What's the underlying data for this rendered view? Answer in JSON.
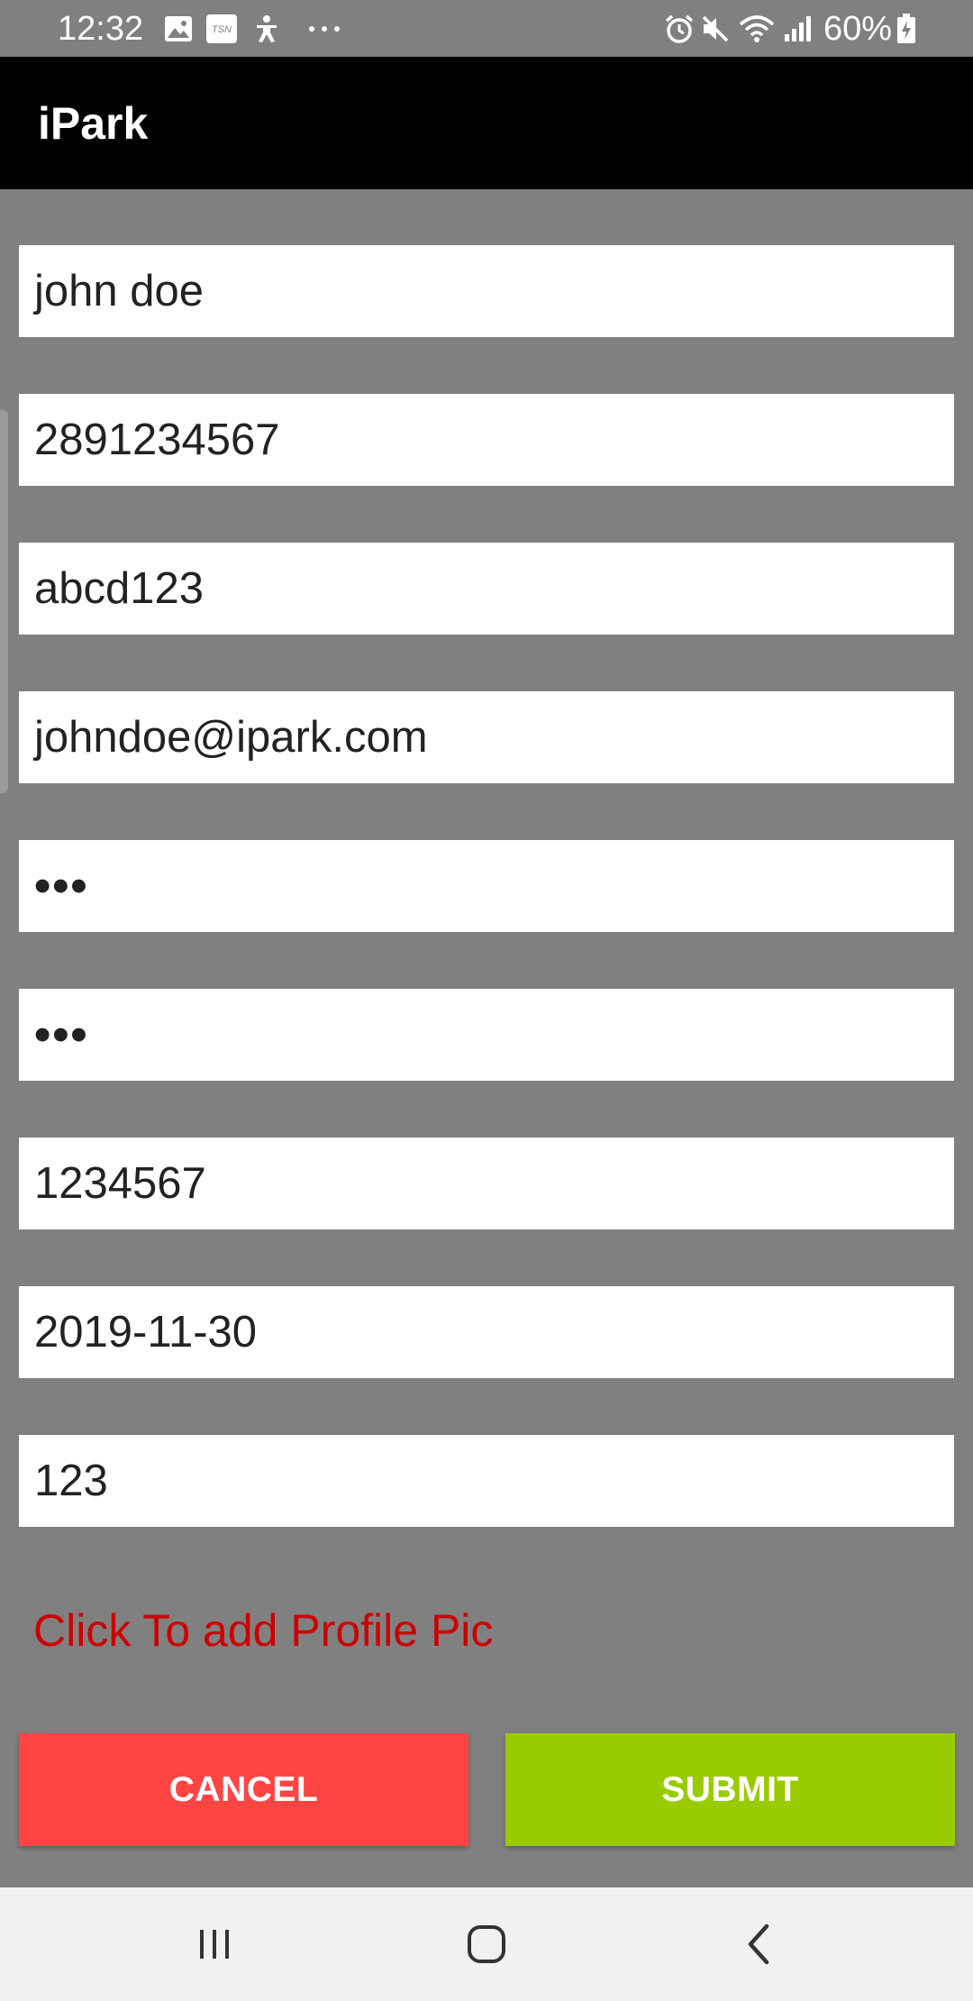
{
  "status_bar": {
    "time": "12:32",
    "battery_percent": "60%",
    "icons": [
      "gallery-icon",
      "tsn-icon",
      "accessibility-icon",
      "more-notifications-icon",
      "alarm-icon",
      "mute-icon",
      "wifi-icon",
      "signal-icon",
      "battery-charging-icon"
    ]
  },
  "app_bar": {
    "title": "iPark"
  },
  "form": {
    "fields": [
      {
        "value": "john doe"
      },
      {
        "value": "2891234567"
      },
      {
        "value": "abcd123"
      },
      {
        "value": "johndoe@ipark.com"
      },
      {
        "value": "•••"
      },
      {
        "value": "•••"
      },
      {
        "value": "1234567"
      },
      {
        "value": "2019-11-30"
      },
      {
        "value": "123"
      }
    ],
    "profile_pic_link": "Click To add Profile Pic",
    "cancel_label": "CANCEL",
    "submit_label": "SUBMIT"
  },
  "colors": {
    "background": "#808080",
    "app_bar": "#000000",
    "cancel": "#ff4444",
    "submit": "#99cc00",
    "link": "#cc0000"
  },
  "nav_bar": {
    "icons": [
      "recent-apps-icon",
      "home-icon",
      "back-icon"
    ]
  }
}
